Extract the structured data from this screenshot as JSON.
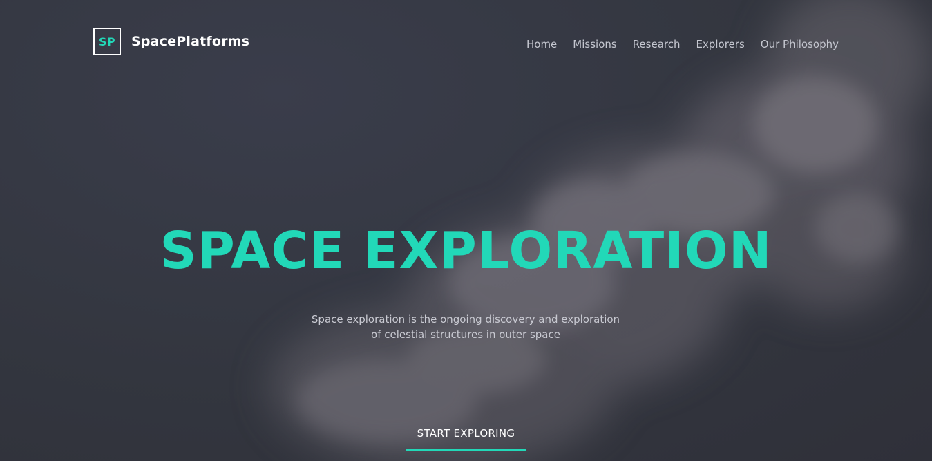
{
  "brand": {
    "logo_mark": "SP",
    "name": "SpacePlatforms"
  },
  "nav": {
    "items": [
      {
        "label": "Home"
      },
      {
        "label": "Missions"
      },
      {
        "label": "Research"
      },
      {
        "label": "Explorers"
      },
      {
        "label": "Our Philosophy"
      }
    ]
  },
  "hero": {
    "title": "SPACE EXPLORATION",
    "subtitle_line1": "Space exploration is the ongoing discovery and exploration",
    "subtitle_line2": "of celestial structures in outer space",
    "cta_label": "START EXPLORING"
  },
  "colors": {
    "accent": "#22d8b8",
    "background": "#33353f",
    "nav_text": "#c5c7d0",
    "white": "#ffffff"
  }
}
